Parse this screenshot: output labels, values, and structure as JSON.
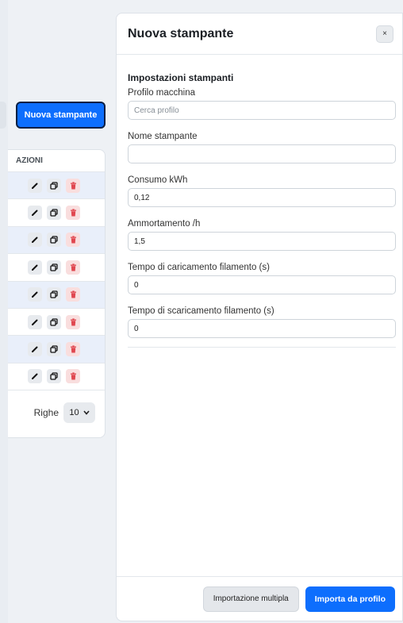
{
  "background": {
    "new_printer_button": "Nuova stampante",
    "table": {
      "actions_header": "AZIONI",
      "row_count": 8,
      "rows_label": "Righe",
      "rows_per_page": "10"
    }
  },
  "modal": {
    "title": "Nuova stampante",
    "close_label": "×",
    "section_title": "Impostazioni stampanti",
    "fields": [
      {
        "label": "Profilo macchina",
        "value": "",
        "placeholder": "Cerca profilo"
      },
      {
        "label": "Nome stampante",
        "value": "",
        "placeholder": ""
      },
      {
        "label": "Consumo kWh",
        "value": "0,12",
        "placeholder": ""
      },
      {
        "label": "Ammortamento /h",
        "value": "1,5",
        "placeholder": ""
      },
      {
        "label": "Tempo di caricamento filamento (s)",
        "value": "0",
        "placeholder": ""
      },
      {
        "label": "Tempo di scaricamento filamento (s)",
        "value": "0",
        "placeholder": ""
      }
    ],
    "footer": {
      "bulk_import_label": "Importazione multipla",
      "import_profile_label": "Importa da profilo"
    }
  },
  "colors": {
    "primary": "#0d6efd",
    "delete_icon": "#e0464f"
  }
}
